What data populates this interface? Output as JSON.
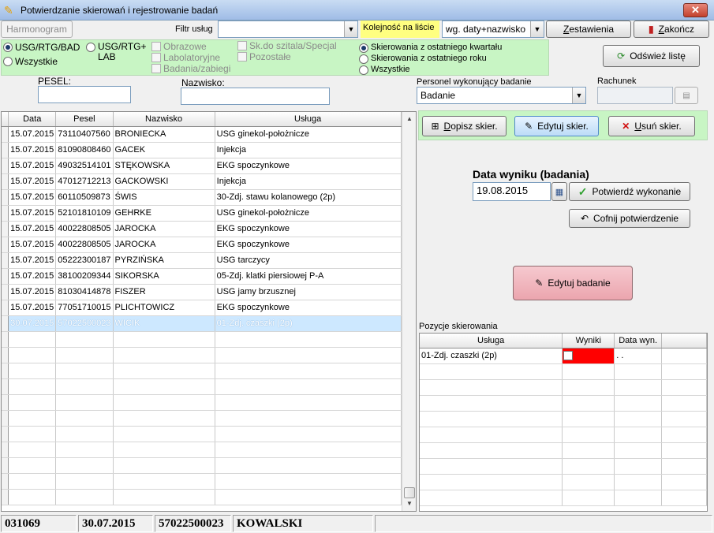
{
  "window": {
    "title": "Potwierdzanie skierowań i rejestrowanie badań",
    "close_label": "✕"
  },
  "toolbar": {
    "harmonogram": "Harmonogram",
    "filter_label": "Filtr usług",
    "filter_value": "",
    "order_label": "Kolejność na liście",
    "order_value": "wg. daty+nazwisko",
    "zestawienia": "Zestawienia",
    "zakoncz": "Zakończ",
    "odswiez": "Odśwież listę"
  },
  "filters": {
    "radio_usg_rtg_bad": "USG/RTG/BAD",
    "radio_wszystkie": "Wszystkie",
    "radio_usg_rtg_lab": "USG/RTG+ LAB",
    "check_obrazowe": "Obrazowe",
    "check_labolatoryjne": "Labolatoryjne",
    "check_badania": "Badania/zabiegi",
    "check_sk_szpitala": "Sk.do szitala/Specjal",
    "check_pozostale": "Pozostałe",
    "period_kwartal": "Skierowania z ostatniego kwartału",
    "period_rok": "Skierowania z ostatniego roku",
    "period_wszystkie": "Wszystkie"
  },
  "search": {
    "pesel_label": "PESEL:",
    "pesel_value": "",
    "nazwisko_label": "Nazwisko:",
    "nazwisko_value": "",
    "personel_label": "Personel wykonujący badanie",
    "personel_value": "Badanie",
    "rachunek_label": "Rachunek",
    "rachunek_value": ""
  },
  "grid": {
    "columns": [
      "Data",
      "Pesel",
      "Nazwisko",
      "Usługa"
    ],
    "rows": [
      [
        "15.07.2015",
        "73110407560",
        "BRONIECKA",
        "USG ginekol-położnicze"
      ],
      [
        "15.07.2015",
        "81090808460",
        "GACEK",
        "Injekcja"
      ],
      [
        "15.07.2015",
        "49032514101",
        "STĘKOWSKA",
        "EKG spoczynkowe"
      ],
      [
        "15.07.2015",
        "47012712213",
        "GACKOWSKI",
        "Injekcja"
      ],
      [
        "15.07.2015",
        "60110509873",
        "ŚWIS",
        "30-Zdj. stawu kolanowego (2p)"
      ],
      [
        "15.07.2015",
        "52101810109",
        "GEHRKE",
        "USG ginekol-położnicze"
      ],
      [
        "15.07.2015",
        "40022808505",
        "JAROCKA",
        "EKG spoczynkowe"
      ],
      [
        "15.07.2015",
        "40022808505",
        "JAROCKA",
        "EKG spoczynkowe"
      ],
      [
        "15.07.2015",
        "05222300187",
        "PYRZIŃSKA",
        "USG tarczycy"
      ],
      [
        "15.07.2015",
        "38100209344",
        "SIKORSKA",
        "05-Zdj. klatki piersiowej P-A"
      ],
      [
        "15.07.2015",
        "81030414878",
        "FISZER",
        "USG jamy brzusznej"
      ],
      [
        "15.07.2015",
        "77051710015",
        "PLICHTOWICZ",
        "EKG spoczynkowe"
      ],
      [
        "30.07.2015",
        "57022500023",
        "WICIK",
        "01-Zdj. czaszki (2p)"
      ]
    ],
    "selected_index": 12
  },
  "actions": {
    "dopisz": "Dopisz skier.",
    "edytuj": "Edytuj skier.",
    "usun": "Usuń skier."
  },
  "result": {
    "date_label": "Data wyniku (badania)",
    "date_value": "19.08.2015",
    "potwierdz": "Potwierdź wykonanie",
    "cofnij": "Cofnij potwierdzenie",
    "edytuj_badanie": "Edytuj badanie"
  },
  "positions": {
    "label": "Pozycje skierowania",
    "columns": [
      "Usługa",
      "Wyniki",
      "Data wyn."
    ],
    "rows": [
      {
        "usluga": "01-Zdj. czaszki (2p)",
        "wyniki": "",
        "data": ". ."
      }
    ]
  },
  "status": {
    "id": "031069",
    "date": "30.07.2015",
    "pesel": "57022500023",
    "name": "KOWALSKI"
  },
  "colors": {
    "green_panel": "#c8f5c4",
    "order_highlight": "#ffff80",
    "selected_row": "#cde8ff",
    "edit_button": "#f2b6bd",
    "result_flag": "#ff0000"
  }
}
